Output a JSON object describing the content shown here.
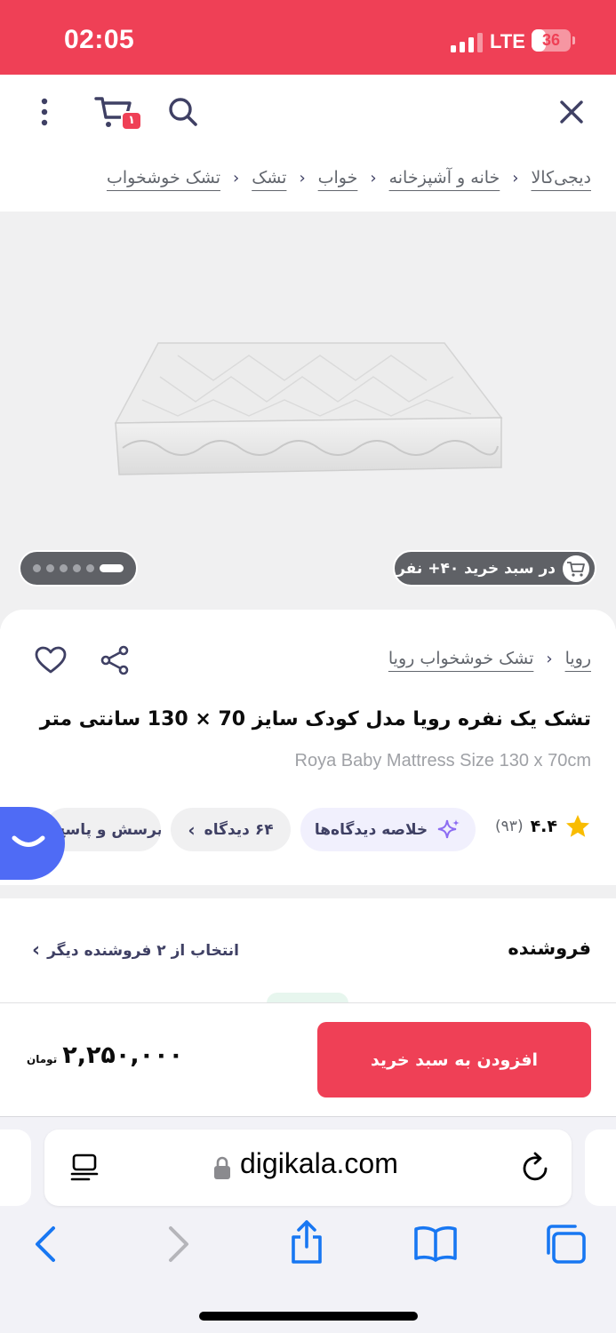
{
  "status_bar": {
    "time": "02:05",
    "network": "LTE",
    "battery_percent": 36,
    "battery_label": "36",
    "signal_bars": 4,
    "signal_bars_active": 3
  },
  "colors": {
    "brand_red": "#ef4056",
    "chat_blue": "#4f6bf5",
    "star": "#f9bc00",
    "ai_purple": "#8c6cf2"
  },
  "toolbar": {
    "cart_count": "۱",
    "icons": [
      "close-icon",
      "search-icon",
      "cart-icon",
      "more-vertical-icon"
    ]
  },
  "breadcrumb": [
    "دیجی‌کالا",
    "خانه و آشپزخانه",
    "خواب",
    "تشک",
    "تشک خوشخواب"
  ],
  "gallery": {
    "cart_users_text": "در سبد خرید ۴۰+ نفر",
    "image_count": 6,
    "active_image": 1
  },
  "product": {
    "brand_crumbs": [
      "رویا",
      "تشک خوشخواب رویا"
    ],
    "title_fa": "تشک یک نفره رویا مدل کودک سایز 70 × 130 سانتی متر",
    "title_en": "Roya Baby Mattress Size 130 x 70cm",
    "rating": "۴.۴",
    "rating_count": "(۹۳)",
    "summary_chip": "خلاصه دیدگاه‌ها",
    "comments_chip": "۶۴ دیدگاه",
    "questions_chip": "۱۱ پرسش و پاسخ"
  },
  "seller": {
    "title": "فروشنده",
    "other_sellers": "انتخاب از ۲ فروشنده دیگر"
  },
  "buy": {
    "add_to_cart": "افزودن به سبد خرید",
    "price": "۲,۲۵۰,۰۰۰",
    "currency": "تومان"
  },
  "browser": {
    "url": "digikala.com"
  }
}
